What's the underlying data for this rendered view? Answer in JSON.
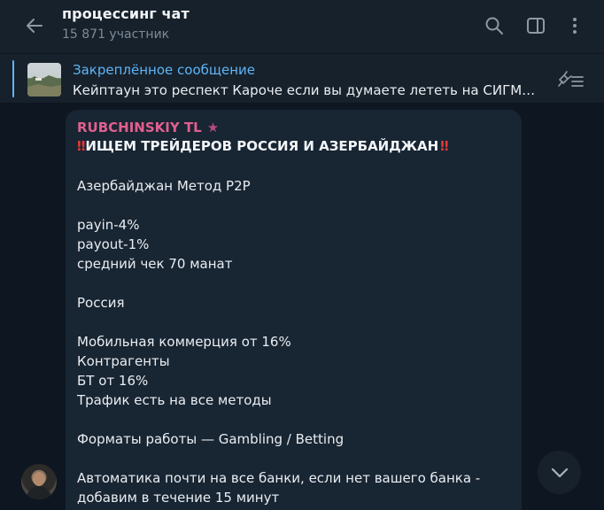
{
  "header": {
    "title": "процессинг чат",
    "subtitle": "15 871 участник"
  },
  "pinned": {
    "title": "Закреплённое сообщение",
    "text": "Кейптаун это респект   Кароче если вы думаете лететь на СИГМУ..."
  },
  "message": {
    "sender": "RUBCHINSKIY TL",
    "sender_star": "★",
    "headline_emoji": "‼",
    "headline": "ИЩЕМ ТРЕЙДЕРОВ РОССИЯ И АЗЕРБАЙДЖАН",
    "lines": [
      "Азербайджан Метод P2P",
      "payin-4%",
      "payout-1%",
      "средний чек 70 манат",
      "Россия",
      "Мобильная коммерция от 16%",
      "Контрагенты",
      "БТ от 16%",
      "Трафик есть на все методы",
      "Форматы работы — Gambling / Betting",
      "Автоматика почти на все банки, если нет вашего банка -",
      "добавим в течение 15 минут"
    ]
  },
  "colors": {
    "background": "#0e1621",
    "header": "#17212b",
    "bubble": "#182533",
    "accent": "#5eb5f7",
    "sender": "#e0608f",
    "muted": "#7d8b99"
  },
  "icons": {
    "back": "arrow-left-icon",
    "search": "search-icon",
    "sidebar": "sidebar-toggle-icon",
    "menu": "more-vertical-icon",
    "unpin": "unpin-list-icon",
    "scroll": "chevron-down-icon"
  }
}
